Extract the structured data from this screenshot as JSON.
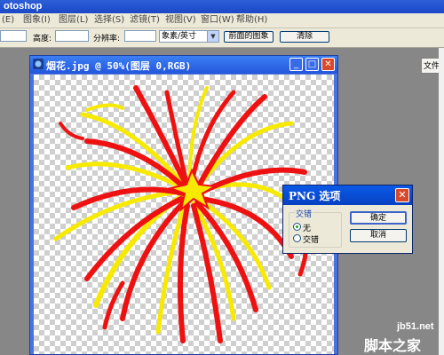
{
  "app": {
    "title": "otoshop"
  },
  "menu": [
    "(E)",
    "图象(I)",
    "图层(L)",
    "选择(S)",
    "滤镜(T)",
    "视图(V)",
    "窗口(W)",
    "帮助(H)"
  ],
  "options": {
    "height_label": "高度:",
    "resolution_label": "分辨率:",
    "unit_select": "象素/英寸",
    "front_image_button": "前面的图象",
    "clear_button": "清除",
    "file_tab": "文件"
  },
  "document": {
    "title": "烟花.jpg @ 50%(图层 0,RGB)",
    "colors": {
      "red": "#ee1111",
      "yellow": "#f7ea00"
    }
  },
  "dialog": {
    "title": "PNG 选项",
    "group_label": "交错",
    "option_none": "无",
    "option_interlaced": "交错",
    "selected": "无",
    "ok_button": "确定",
    "cancel_button": "取消"
  },
  "watermark": {
    "site": "jb51.net",
    "brand": "脚本之家"
  }
}
